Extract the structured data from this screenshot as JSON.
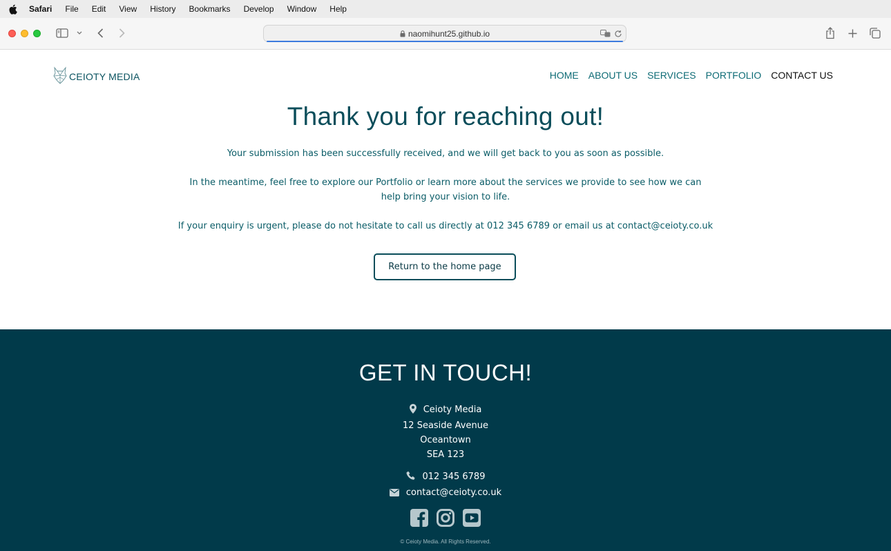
{
  "menubar": {
    "items": [
      "Safari",
      "File",
      "Edit",
      "View",
      "History",
      "Bookmarks",
      "Develop",
      "Window",
      "Help"
    ]
  },
  "browser": {
    "url": "naomihunt25.github.io"
  },
  "site": {
    "logo_text": "CEIOTY MEDIA",
    "nav": [
      "HOME",
      "ABOUT US",
      "SERVICES",
      "PORTFOLIO",
      "CONTACT US"
    ],
    "active_nav": "CONTACT US"
  },
  "main": {
    "heading": "Thank you for reaching out!",
    "p1": "Your submission has been successfully received, and we will get back to you as soon as possible.",
    "p2": "In the meantime, feel free to explore our Portfolio or learn more about the services we provide to see how we can help bring your vision to life.",
    "p3": "If your enquiry is urgent, please do not hesitate to call us directly at 012 345 6789 or email us at contact@ceioty.co.uk",
    "button": "Return to the home page"
  },
  "footer": {
    "heading": "GET IN TOUCH!",
    "address": [
      "Ceioty Media",
      "12 Seaside Avenue",
      "Oceantown",
      "SEA 123"
    ],
    "phone": "012 345 6789",
    "email": "contact@ceioty.co.uk",
    "social": [
      "facebook-icon",
      "instagram-icon",
      "youtube-icon"
    ],
    "copyright": "© Ceioty Media. All Rights Reserved."
  },
  "colors": {
    "brand_teal": "#0a4d5a",
    "footer_bg": "#013a4a",
    "nav_link": "#0d6b75"
  }
}
